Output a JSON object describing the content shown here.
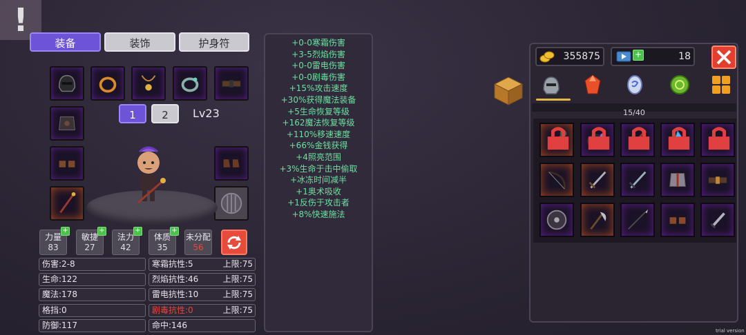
{
  "alert": "!",
  "tabs": [
    {
      "label": "装备",
      "active": true
    },
    {
      "label": "装饰",
      "active": false
    },
    {
      "label": "护身符",
      "active": false
    }
  ],
  "loadout_pages": [
    "1",
    "2"
  ],
  "level": "Lv23",
  "attributes": [
    {
      "name": "力量",
      "value": "83"
    },
    {
      "name": "敏捷",
      "value": "27"
    },
    {
      "name": "法力",
      "value": "42"
    },
    {
      "name": "体质",
      "value": "35"
    },
    {
      "name": "未分配",
      "value": "56"
    }
  ],
  "stats_left": [
    "伤害:2-8",
    "生命:122",
    "魔法:178",
    "格挡:0",
    "防御:117"
  ],
  "stats_right": [
    {
      "label": "寒霜抗性:5",
      "limit": "上限:75"
    },
    {
      "label": "烈焰抗性:46",
      "limit": "上限:75"
    },
    {
      "label": "雷电抗性:10",
      "limit": "上限:75"
    },
    {
      "label": "剧毒抗性:0",
      "limit": "上限:75"
    },
    {
      "label": "命中:146",
      "limit": ""
    }
  ],
  "bonuses": [
    "+0-0寒霜伤害",
    "+3-5烈焰伤害",
    "+0-0雷电伤害",
    "+0-0剧毒伤害",
    "+15%攻击速度",
    "+30%获得魔法装备",
    "+5生命恢复等级",
    "+162魔法恢复等级",
    "+110%移速速度",
    "+66%金钱获得",
    "+4照亮范围",
    "+3%生命于击中偷取",
    "+冰冻时间减半",
    "+1奥术吸收",
    "+1反伤于攻击者",
    "+8%快速施法"
  ],
  "gold": "355875",
  "tickets": "18",
  "capacity": "15/40",
  "categories": [
    "helmet-icon",
    "red-gem-icon",
    "rune-stone-icon",
    "green-orb-icon",
    "grid-menu-icon"
  ],
  "colors": {
    "accent": "#6c53d8",
    "bonus_text": "#6de0a0",
    "warning": "#e8463a"
  },
  "trial": "trial version"
}
